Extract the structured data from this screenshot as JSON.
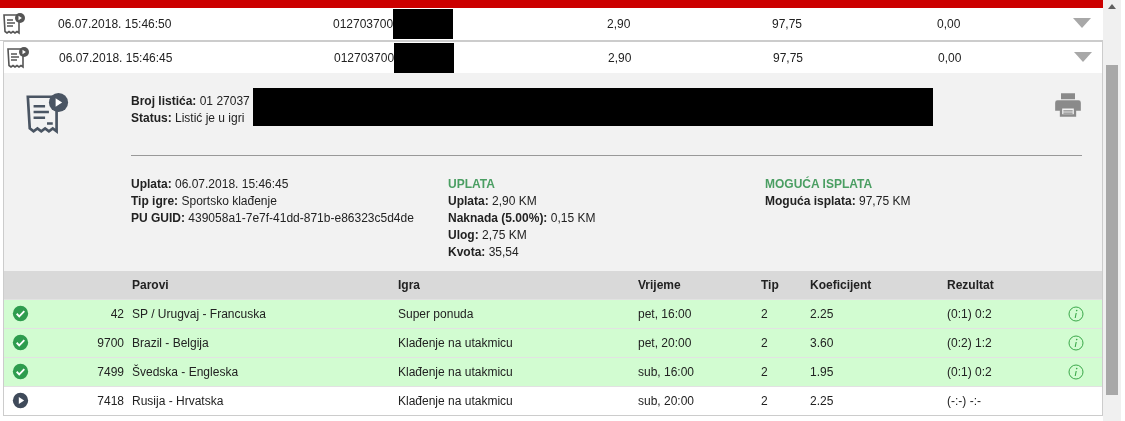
{
  "tickets": [
    {
      "date": "06.07.2018. 15:46:50",
      "number": "012703700",
      "stake": "2,90",
      "payout": "97,75",
      "win": "0,00",
      "expanded": false
    },
    {
      "date": "06.07.2018. 15:46:45",
      "number": "012703700",
      "stake": "2,90",
      "payout": "97,75",
      "win": "0,00",
      "expanded": true
    }
  ],
  "detail": {
    "header": [
      {
        "label": "Broj listića:",
        "value": "01 27037"
      },
      {
        "label": "Status:",
        "value": "Listić je u igri"
      }
    ],
    "columns": [
      {
        "fields": [
          {
            "label": "Uplata:",
            "value": "06.07.2018. 15:46:45"
          },
          {
            "label": "Tip igre:",
            "value": "Sportsko klađenje"
          },
          {
            "label": "PU GUID:",
            "value": "439058a1-7e7f-41dd-871b-e86323c5d4de"
          }
        ]
      },
      {
        "heading": "UPLATA",
        "fields": [
          {
            "label": "Uplata:",
            "value": "2,90 KM"
          },
          {
            "label": "Naknada (5.00%):",
            "value": "0,15 KM"
          },
          {
            "label": "Ulog:",
            "value": "2,75 KM"
          },
          {
            "label": "Kvota:",
            "value": "35,54"
          }
        ]
      },
      {
        "heading": "MOGUĆA ISPLATA",
        "fields": [
          {
            "label": "Moguća isplata:",
            "value": "97,75 KM"
          }
        ]
      }
    ]
  },
  "matches": {
    "columns": [
      "Parovi",
      "Igra",
      "Vrijeme",
      "Tip",
      "Koeficijent",
      "Rezultat"
    ],
    "rows": [
      {
        "kind": "won",
        "code": "42",
        "pair": "SP / Urugvaj - Francuska",
        "game": "Super ponuda",
        "time": "pet, 16:00",
        "tip": "2",
        "odds": "2.25",
        "result": "(0:1) 0:2"
      },
      {
        "kind": "won",
        "code": "9700",
        "pair": "Brazil - Belgija",
        "game": "Klađenje na utakmicu",
        "time": "pet, 20:00",
        "tip": "2",
        "odds": "3.60",
        "result": "(0:2) 1:2"
      },
      {
        "kind": "won",
        "code": "7499",
        "pair": "Švedska - Engleska",
        "game": "Klađenje na utakmicu",
        "time": "sub, 16:00",
        "tip": "2",
        "odds": "1.95",
        "result": "(0:1) 0:2"
      },
      {
        "kind": "live",
        "code": "7418",
        "pair": "Rusija - Hrvatska",
        "game": "Klađenje na utakmicu",
        "time": "sub, 20:00",
        "tip": "2",
        "odds": "2.25",
        "result": "(-:-) -:-"
      }
    ]
  }
}
